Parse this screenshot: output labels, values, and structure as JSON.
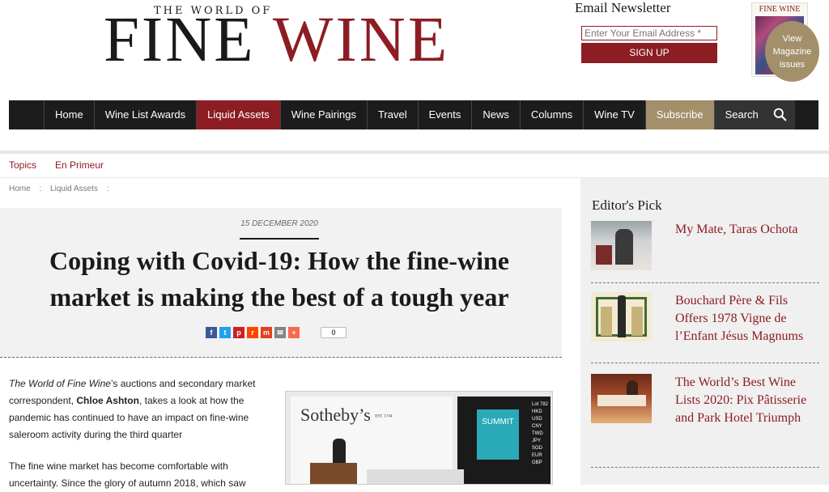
{
  "header": {
    "logo_small": "THE WORLD OF",
    "logo_fine": "FINE",
    "logo_wine": "WINE",
    "newsletter_title": "Email Newsletter",
    "email_placeholder": "Enter Your Email Address *",
    "signup_label": "SIGN UP",
    "magazine_title": "FINE WINE",
    "view_issues_label": "View Magazine issues"
  },
  "nav": {
    "items": [
      {
        "label": "Home"
      },
      {
        "label": "Wine List Awards"
      },
      {
        "label": "Liquid Assets",
        "active": true
      },
      {
        "label": "Wine Pairings"
      },
      {
        "label": "Travel"
      },
      {
        "label": "Events"
      },
      {
        "label": "News"
      },
      {
        "label": "Columns"
      },
      {
        "label": "Wine TV"
      },
      {
        "label": "Subscribe"
      },
      {
        "label": "Search"
      }
    ]
  },
  "subnav": {
    "items": [
      {
        "label": "Topics"
      },
      {
        "label": "En Primeur"
      }
    ]
  },
  "breadcrumb": {
    "home": "Home",
    "section": "Liquid Assets",
    "separator": ":"
  },
  "article": {
    "date": "15 DECEMBER 2020",
    "headline_line1": "Coping with Covid-19: How the fine-wine",
    "headline_line2": "market is making the best of a tough year",
    "share_count": "0",
    "intro_em": "The World of Fine Wine",
    "intro_a": "’s auctions and secondary market correspondent, ",
    "intro_author": "Chloe Ashton",
    "intro_b": ", takes a look at how the pandemic has continued to have an impact on fine-wine saleroom activity during the third quarter",
    "para2": "The fine wine market has become comfortable with uncertainty. Since the glory of autumn 2018, which saw",
    "photo": {
      "brand": "Sotheby’s",
      "brand_small": "EST. 1744",
      "screen_label": "SUMMIT",
      "lot_label": "Lot 782",
      "currencies": [
        "HKD",
        "USD",
        "CNY",
        "TWD",
        "JPY",
        "SGD",
        "EUR",
        "GBP"
      ]
    }
  },
  "sidebar": {
    "title": "Editor's Pick",
    "picks": [
      {
        "title": "My Mate, Taras Ochota"
      },
      {
        "title": "Bouchard Père & Fils Offers 1978 Vigne de l’Enfant Jésus Magnums"
      },
      {
        "title": "The World’s Best Wine Lists 2020: Pix Pâtisserie and Park Hotel Triumph"
      }
    ]
  },
  "colors": {
    "brand_red": "#8c1d23",
    "gold": "#a3906a",
    "nav_bg": "#1c1c1c"
  }
}
